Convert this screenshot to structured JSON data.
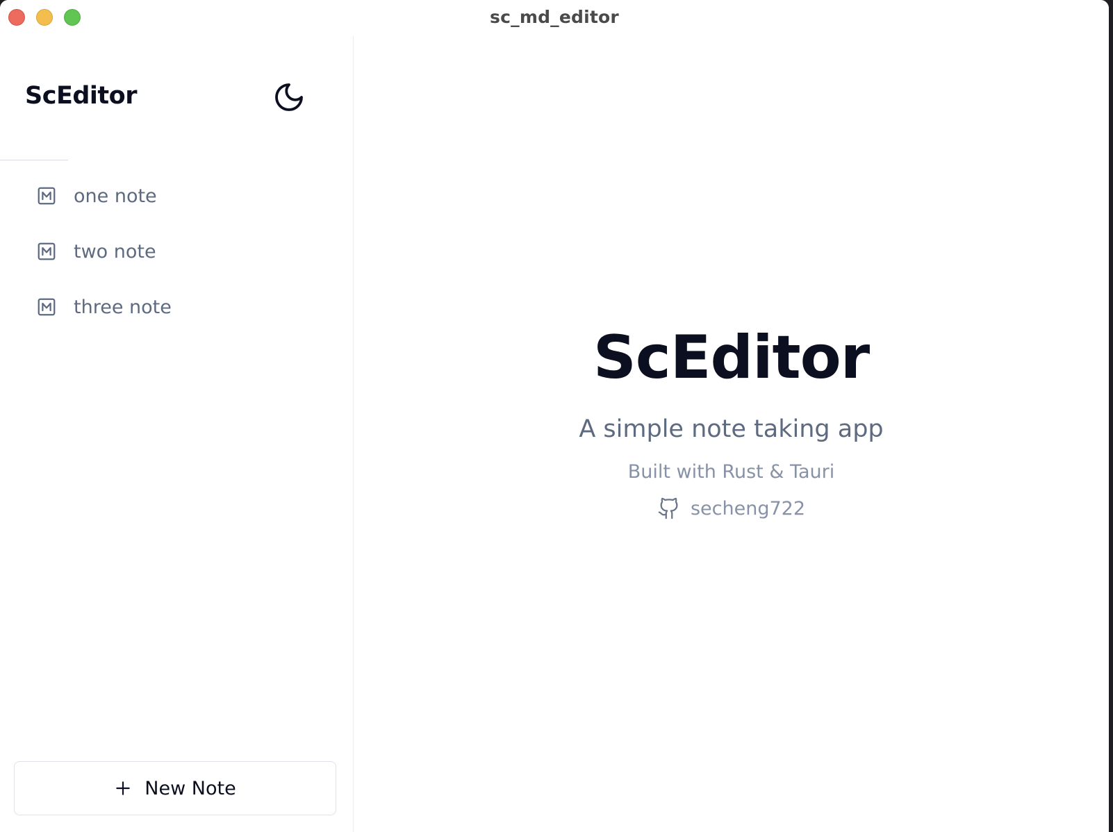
{
  "window": {
    "title": "sc_md_editor",
    "controls": {
      "close": "close-button",
      "minimize": "minimize-button",
      "maximize": "maximize-button"
    },
    "control_colors": {
      "close": "#ec6a5e",
      "minimize": "#f4be4f",
      "maximize": "#61c554"
    }
  },
  "sidebar": {
    "brand": "ScEditor",
    "theme_toggle_icon": "moon-icon",
    "notes": [
      {
        "label": "one note",
        "icon": "markdown-icon"
      },
      {
        "label": "two note",
        "icon": "markdown-icon"
      },
      {
        "label": "three note",
        "icon": "markdown-icon"
      }
    ],
    "new_note_button": {
      "icon": "plus-icon",
      "label": "New Note"
    }
  },
  "main": {
    "title": "ScEditor",
    "subtitle": "A simple note taking app",
    "built_with": "Built with Rust & Tauri",
    "github": {
      "icon": "github-icon",
      "username": "secheng722"
    }
  },
  "colors": {
    "text_primary": "#0b0f1f",
    "text_secondary": "#5e6a80",
    "text_muted": "#8892a6",
    "border": "#dfe2e8"
  }
}
